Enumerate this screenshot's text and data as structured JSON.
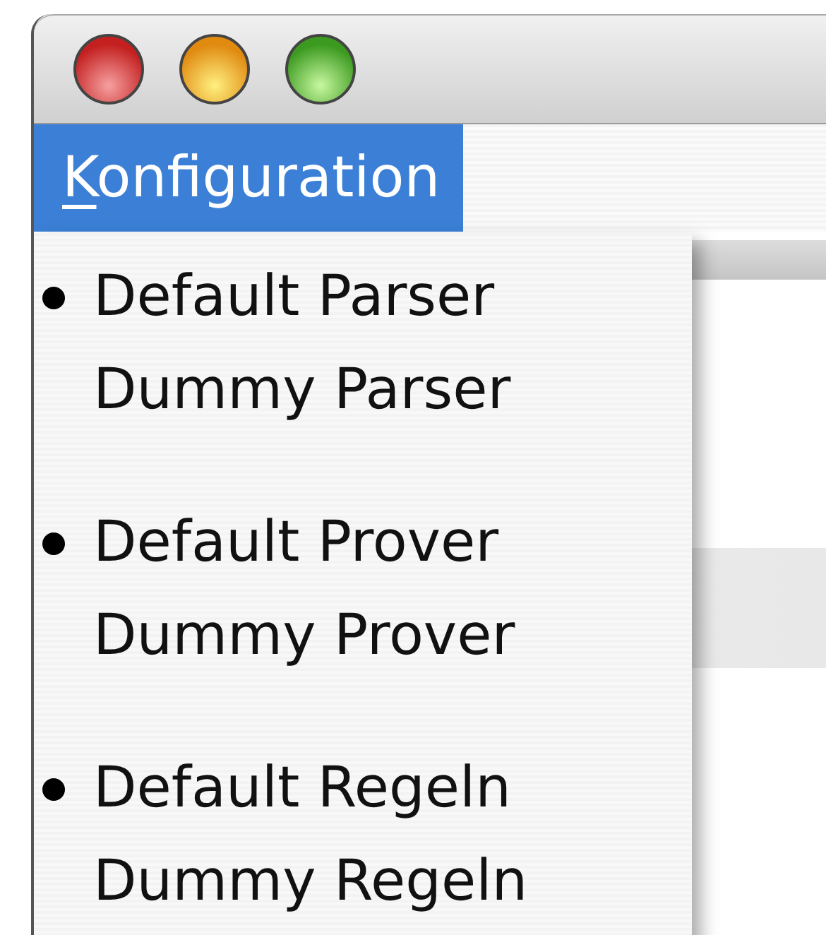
{
  "menu": {
    "title": "Konfiguration",
    "open": true,
    "groups": [
      {
        "items": [
          {
            "label": "Default Parser",
            "selected": true
          },
          {
            "label": "Dummy Parser",
            "selected": false
          }
        ]
      },
      {
        "items": [
          {
            "label": "Default Prover",
            "selected": true
          },
          {
            "label": "Dummy Prover",
            "selected": false
          }
        ]
      },
      {
        "items": [
          {
            "label": "Default Regeln",
            "selected": true
          },
          {
            "label": "Dummy Regeln",
            "selected": false
          }
        ]
      }
    ]
  }
}
